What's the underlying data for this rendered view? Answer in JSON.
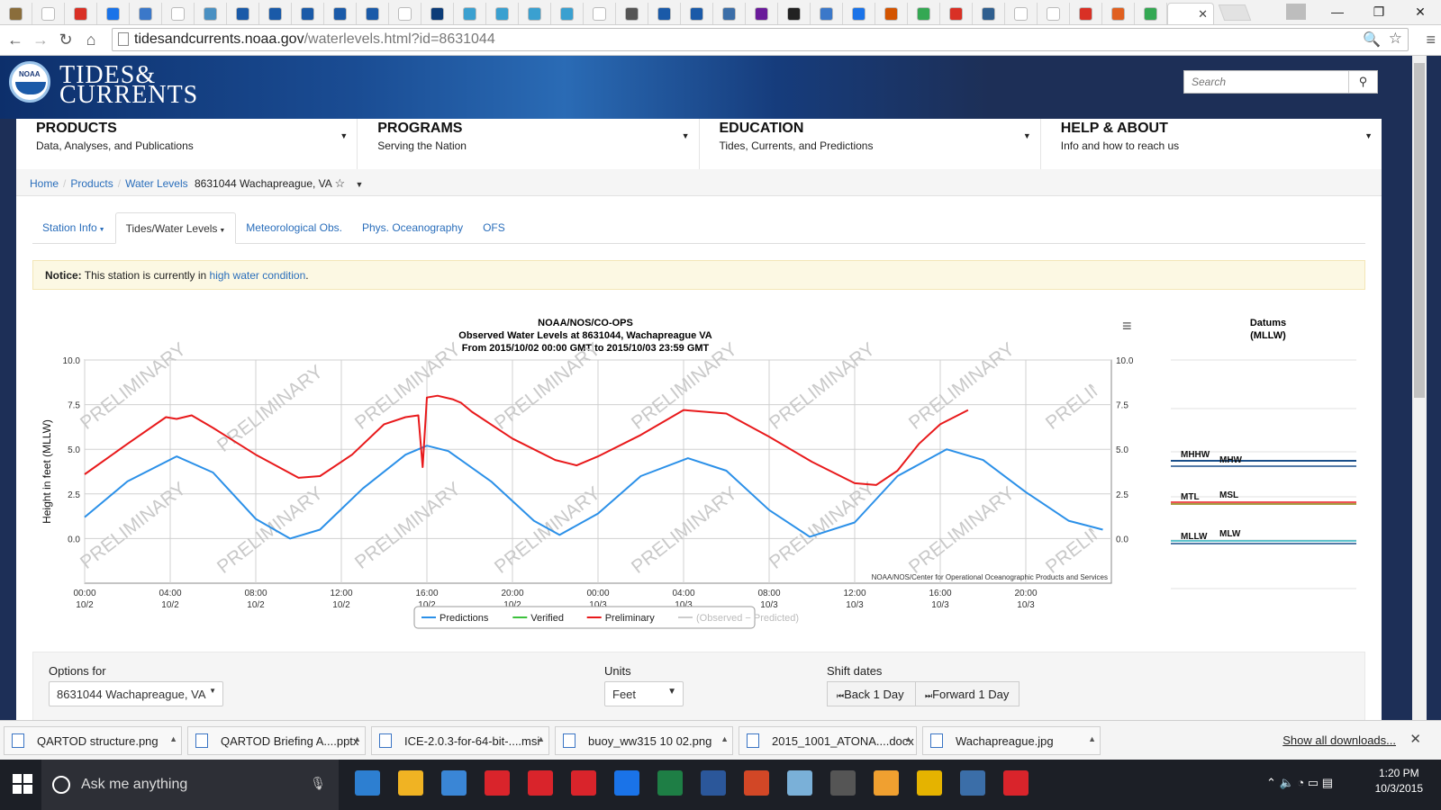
{
  "browser": {
    "url_host": "tidesandcurrents.noaa.gov",
    "url_path": "/waterlevels.html?id=8631044",
    "close_glyph": "✕",
    "win_min": "—",
    "win_max": "❐",
    "win_close": "✕",
    "favicons": [
      "#8a6d3b",
      "#fff",
      "#d93025",
      "#1a73e8",
      "#3b78c9",
      "#fff",
      "#4a90c2",
      "#1a5aa8",
      "#1a5aa8",
      "#1a5aa8",
      "#1a5aa8",
      "#1a5aa8",
      "#fff",
      "#0c3c78",
      "#3aa0d0",
      "#3aa0d0",
      "#3aa0d0",
      "#3aa0d0",
      "#fff",
      "#555",
      "#1a5aa8",
      "#1a5aa8",
      "#3b6ea8",
      "#6a1b9a",
      "#222",
      "#3b78c9",
      "#1a73e8",
      "#d35400",
      "#34a853",
      "#d93025",
      "#2f5f8f",
      "#fff",
      "#fff",
      "#d93025",
      "#e06020",
      "#34a853"
    ]
  },
  "banner": {
    "logo_text": "NOAA",
    "title_line1": "TIDES&",
    "title_line2": "CURRENTS",
    "search_placeholder": "Search"
  },
  "nav": [
    {
      "title": "PRODUCTS",
      "sub": "Data, Analyses, and Publications"
    },
    {
      "title": "PROGRAMS",
      "sub": "Serving the Nation"
    },
    {
      "title": "EDUCATION",
      "sub": "Tides, Currents, and Predictions"
    },
    {
      "title": "HELP & ABOUT",
      "sub": "Info and how to reach us"
    }
  ],
  "breadcrumb": {
    "home": "Home",
    "products": "Products",
    "water_levels": "Water Levels",
    "current": "8631044 Wachapreague, VA"
  },
  "tabs": [
    "Station Info",
    "Tides/Water Levels",
    "Meteorological Obs.",
    "Phys. Oceanography",
    "OFS"
  ],
  "notice": {
    "label": "Notice:",
    "text": " This station is currently in ",
    "link": "high water condition",
    "end": "."
  },
  "options": {
    "options_for_label": "Options for",
    "station_value": "8631044 Wachapreague, VA",
    "units_label": "Units",
    "units_value": "Feet",
    "shift_label": "Shift dates",
    "back": "Back 1 Day",
    "forward": "Forward 1 Day"
  },
  "chart_data": {
    "type": "line",
    "title": "NOAA/NOS/CO-OPS",
    "subtitle1": "Observed Water Levels at 8631044, Wachapreague VA",
    "subtitle2": "From 2015/10/02 00:00 GMT to 2015/10/03 23:59 GMT",
    "ylabel": "Height in feet (MLLW)",
    "ylim": [
      -2.5,
      10
    ],
    "yticks": [
      "10.0",
      "7.5",
      "5.0",
      "2.5",
      "0.0"
    ],
    "xticks": [
      {
        "time": "00:00",
        "day": "10/2"
      },
      {
        "time": "04:00",
        "day": "10/2"
      },
      {
        "time": "08:00",
        "day": "10/2"
      },
      {
        "time": "12:00",
        "day": "10/2"
      },
      {
        "time": "16:00",
        "day": "10/2"
      },
      {
        "time": "20:00",
        "day": "10/2"
      },
      {
        "time": "00:00",
        "day": "10/3"
      },
      {
        "time": "04:00",
        "day": "10/3"
      },
      {
        "time": "08:00",
        "day": "10/3"
      },
      {
        "time": "12:00",
        "day": "10/3"
      },
      {
        "time": "16:00",
        "day": "10/3"
      },
      {
        "time": "20:00",
        "day": "10/3"
      }
    ],
    "watermark": "PRELIMINARY",
    "credit": "NOAA/NOS/Center for Operational Oceanographic Products and Services",
    "series": [
      {
        "name": "Predictions",
        "color": "#2b90e8",
        "x": [
          0,
          2,
          4.3,
          6,
          8,
          9.6,
          11,
          13,
          15,
          16,
          17,
          19,
          21,
          22.2,
          24,
          26,
          28.2,
          30,
          32,
          33.9,
          36,
          38,
          40.3,
          42,
          44,
          46,
          47.6
        ],
        "y": [
          1.2,
          3.2,
          4.6,
          3.7,
          1.1,
          0.0,
          0.5,
          2.8,
          4.7,
          5.2,
          4.9,
          3.2,
          1.0,
          0.2,
          1.4,
          3.5,
          4.5,
          3.8,
          1.6,
          0.1,
          0.9,
          3.5,
          5.0,
          4.4,
          2.6,
          1.0,
          0.5
        ]
      },
      {
        "name": "Verified",
        "color": "#3cc13c",
        "x": [],
        "y": []
      },
      {
        "name": "Preliminary",
        "color": "#e8191b",
        "x": [
          0,
          2,
          3.8,
          4.3,
          5,
          6,
          8,
          10,
          11,
          12.5,
          14,
          15,
          15.6,
          15.8,
          16,
          16.5,
          17.2,
          17.6,
          18.1,
          20,
          22,
          23,
          24,
          26,
          28,
          30,
          32,
          34,
          36,
          37,
          38,
          39,
          40,
          41.3
        ],
        "y": [
          3.6,
          5.3,
          6.8,
          6.7,
          6.9,
          6.2,
          4.7,
          3.4,
          3.5,
          4.7,
          6.4,
          6.8,
          6.9,
          4.0,
          7.9,
          8.0,
          7.8,
          7.6,
          7.1,
          5.6,
          4.4,
          4.1,
          4.6,
          5.8,
          7.2,
          7.0,
          5.7,
          4.3,
          3.1,
          3.0,
          3.8,
          5.3,
          6.4,
          7.2
        ]
      },
      {
        "name": "(Observed − Predicted)",
        "color": "#cccccc",
        "x": [],
        "y": []
      }
    ],
    "datums": {
      "title": "Datums",
      "subtitle": "(MLLW)",
      "labels": [
        "MHHW",
        "MHW",
        "MTL",
        "MSL",
        "MLLW",
        "MLW"
      ]
    }
  },
  "downloads": {
    "items": [
      "QARTOD structure.png",
      "QARTOD Briefing  A....pptx",
      "ICE-2.0.3-for-64-bit-....msi",
      "buoy_ww315 10 02.png",
      "2015_1001_ATONA....docx",
      "Wachapreague.jpg"
    ],
    "show_all": "Show all downloads..."
  },
  "taskbar": {
    "search_text": "Ask me anything",
    "time": "1:20 PM",
    "date": "10/3/2015",
    "app_colors": [
      "#2d7fd1",
      "#f0b323",
      "#3a86d6",
      "#d9242b",
      "#d9242b",
      "#d9242b",
      "#1a73e8",
      "#1e7e45",
      "#2b579a",
      "#d24726",
      "#7ab0d8",
      "#555",
      "#f0a030",
      "#e5b300",
      "#3b6ea8",
      "#d9242b"
    ]
  }
}
